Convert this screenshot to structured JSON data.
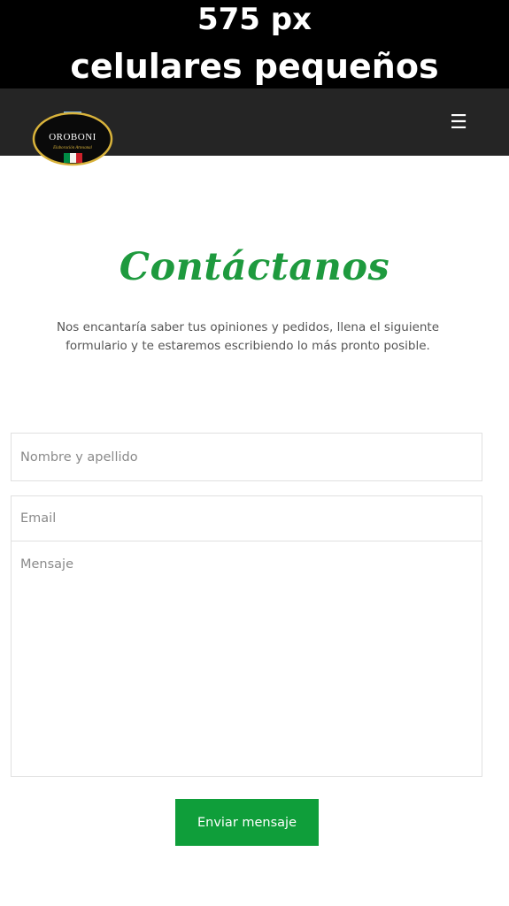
{
  "banner": {
    "line1": "575 px",
    "line2": "celulares pequeños"
  },
  "navbar": {
    "logo": {
      "brand": "OROBONI",
      "tagline": "Elaboración Artesanal"
    },
    "menu_icon": "☰"
  },
  "contact": {
    "title": "Contáctanos",
    "intro": "Nos encantaría saber tus opiniones y pedidos, llena el siguiente formulario y te estaremos escribiendo lo más pronto posible.",
    "form": {
      "name_placeholder": "Nombre y apellido",
      "email_placeholder": "Email",
      "message_placeholder": "Mensaje",
      "submit_label": "Enviar mensaje"
    }
  },
  "colors": {
    "navbar": "#252525",
    "accent": "#1e9a3e",
    "button": "#0f9e3a"
  }
}
